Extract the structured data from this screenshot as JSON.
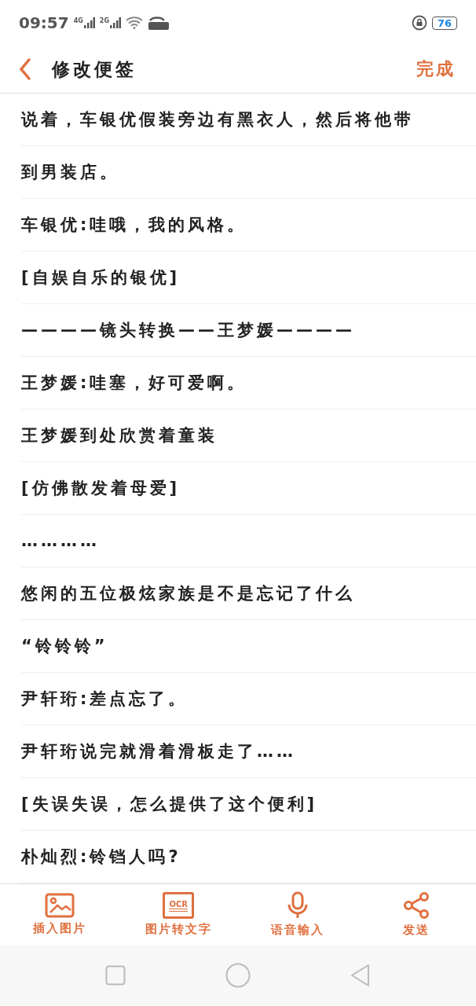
{
  "status_bar": {
    "time": "09:57",
    "network_1": "4G",
    "network_2": "2G",
    "battery": "76"
  },
  "header": {
    "title": "修改便签",
    "done": "完成"
  },
  "lines": [
    "说着，车银优假装旁边有黑衣人，然后将他带",
    "到男装店。",
    "车银优:哇哦，我的风格。",
    "[自娱自乐的银优]",
    "————镜头转换——王梦媛————",
    "王梦媛:哇塞，好可爱啊。",
    "王梦媛到处欣赏着童装",
    "[仿佛散发着母爱]",
    "…………",
    "悠闲的五位极炫家族是不是忘记了什么",
    "“铃铃铃”",
    "尹轩珩:差点忘了。",
    "尹轩珩说完就滑着滑板走了……",
    "[失误失误，怎么提供了这个便利]",
    "朴灿烈:铃铛人吗?"
  ],
  "toolbar": [
    {
      "kind": "image",
      "label": "插入图片"
    },
    {
      "kind": "ocr",
      "label": "图片转文字",
      "badge": "OCR"
    },
    {
      "kind": "mic",
      "label": "语音输入"
    },
    {
      "kind": "share",
      "label": "发送"
    }
  ]
}
